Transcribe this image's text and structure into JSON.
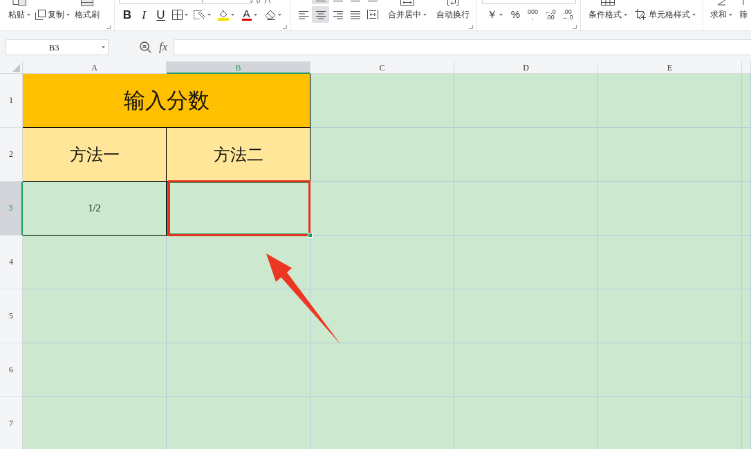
{
  "toolbar": {
    "paste": {
      "label": "粘贴"
    },
    "copy": {
      "label": "复制"
    },
    "format_painter": {
      "label": "格式刷"
    },
    "font_styles": [
      {
        "kind": "bold",
        "label": "B"
      },
      {
        "kind": "italic",
        "label": "I"
      },
      {
        "kind": "underline",
        "label": "U"
      }
    ],
    "font_color": {
      "label": "A"
    },
    "valign_buttons": [
      {
        "selected": true
      },
      {
        "selected": false
      },
      {
        "selected": false
      },
      {
        "selected": false
      }
    ],
    "align_buttons": [
      {
        "selected": false
      },
      {
        "selected": true
      },
      {
        "selected": false
      },
      {
        "selected": false
      },
      {
        "selected": false
      }
    ],
    "merge": {
      "label": "合并居中"
    },
    "wrap": {
      "label": "自动换行"
    },
    "number_buttons": [
      {
        "kind": "currency",
        "lines": [
          "￥"
        ]
      },
      {
        "kind": "percent",
        "lines": [
          "%"
        ]
      },
      {
        "kind": "thousands",
        "lines": [
          "000",
          ","
        ]
      },
      {
        "kind": "decimal",
        "lines": [
          "←.0",
          ".00"
        ]
      },
      {
        "kind": "decimal",
        "lines": [
          ".00",
          "→.0"
        ]
      }
    ],
    "conditional_format": {
      "label": "条件格式"
    },
    "cell_style": {
      "label": "单元格样式"
    },
    "sum": {
      "label": "求和"
    },
    "filter": {
      "label": "筛"
    }
  },
  "formula_bar": {
    "name_box": "B3",
    "function_label": "fx"
  },
  "sheet": {
    "columns": [
      {
        "label": "A",
        "selected": false
      },
      {
        "label": "B",
        "selected": true
      },
      {
        "label": "C",
        "selected": false
      },
      {
        "label": "D",
        "selected": false
      },
      {
        "label": "E",
        "selected": false
      }
    ],
    "rows": [
      {
        "label": "1",
        "selected": false
      },
      {
        "label": "2",
        "selected": false
      },
      {
        "label": "3",
        "selected": true
      },
      {
        "label": "4",
        "selected": false
      },
      {
        "label": "5",
        "selected": false
      },
      {
        "label": "6",
        "selected": false
      },
      {
        "label": "7",
        "selected": false
      }
    ],
    "title": "输入分数",
    "headers": [
      "方法一",
      "方法二"
    ],
    "values": [
      {
        "text": "1/2",
        "selected": false,
        "highlighted": false
      },
      {
        "selected": true,
        "highlighted": true
      }
    ]
  },
  "pointer_arrow": true
}
